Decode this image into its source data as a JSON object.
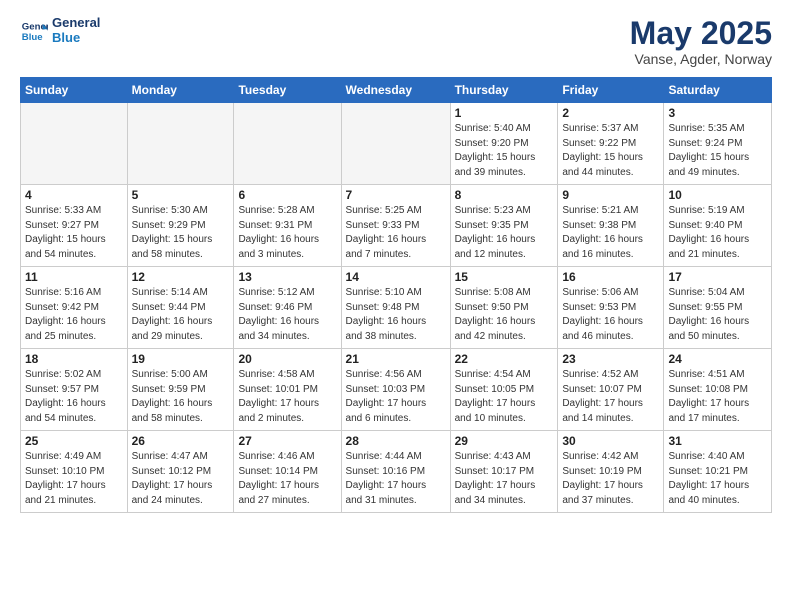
{
  "logo": {
    "line1": "General",
    "line2": "Blue"
  },
  "title": "May 2025",
  "subtitle": "Vanse, Agder, Norway",
  "days_of_week": [
    "Sunday",
    "Monday",
    "Tuesday",
    "Wednesday",
    "Thursday",
    "Friday",
    "Saturday"
  ],
  "weeks": [
    [
      {
        "day": "",
        "info": ""
      },
      {
        "day": "",
        "info": ""
      },
      {
        "day": "",
        "info": ""
      },
      {
        "day": "",
        "info": ""
      },
      {
        "day": "1",
        "info": "Sunrise: 5:40 AM\nSunset: 9:20 PM\nDaylight: 15 hours\nand 39 minutes."
      },
      {
        "day": "2",
        "info": "Sunrise: 5:37 AM\nSunset: 9:22 PM\nDaylight: 15 hours\nand 44 minutes."
      },
      {
        "day": "3",
        "info": "Sunrise: 5:35 AM\nSunset: 9:24 PM\nDaylight: 15 hours\nand 49 minutes."
      }
    ],
    [
      {
        "day": "4",
        "info": "Sunrise: 5:33 AM\nSunset: 9:27 PM\nDaylight: 15 hours\nand 54 minutes."
      },
      {
        "day": "5",
        "info": "Sunrise: 5:30 AM\nSunset: 9:29 PM\nDaylight: 15 hours\nand 58 minutes."
      },
      {
        "day": "6",
        "info": "Sunrise: 5:28 AM\nSunset: 9:31 PM\nDaylight: 16 hours\nand 3 minutes."
      },
      {
        "day": "7",
        "info": "Sunrise: 5:25 AM\nSunset: 9:33 PM\nDaylight: 16 hours\nand 7 minutes."
      },
      {
        "day": "8",
        "info": "Sunrise: 5:23 AM\nSunset: 9:35 PM\nDaylight: 16 hours\nand 12 minutes."
      },
      {
        "day": "9",
        "info": "Sunrise: 5:21 AM\nSunset: 9:38 PM\nDaylight: 16 hours\nand 16 minutes."
      },
      {
        "day": "10",
        "info": "Sunrise: 5:19 AM\nSunset: 9:40 PM\nDaylight: 16 hours\nand 21 minutes."
      }
    ],
    [
      {
        "day": "11",
        "info": "Sunrise: 5:16 AM\nSunset: 9:42 PM\nDaylight: 16 hours\nand 25 minutes."
      },
      {
        "day": "12",
        "info": "Sunrise: 5:14 AM\nSunset: 9:44 PM\nDaylight: 16 hours\nand 29 minutes."
      },
      {
        "day": "13",
        "info": "Sunrise: 5:12 AM\nSunset: 9:46 PM\nDaylight: 16 hours\nand 34 minutes."
      },
      {
        "day": "14",
        "info": "Sunrise: 5:10 AM\nSunset: 9:48 PM\nDaylight: 16 hours\nand 38 minutes."
      },
      {
        "day": "15",
        "info": "Sunrise: 5:08 AM\nSunset: 9:50 PM\nDaylight: 16 hours\nand 42 minutes."
      },
      {
        "day": "16",
        "info": "Sunrise: 5:06 AM\nSunset: 9:53 PM\nDaylight: 16 hours\nand 46 minutes."
      },
      {
        "day": "17",
        "info": "Sunrise: 5:04 AM\nSunset: 9:55 PM\nDaylight: 16 hours\nand 50 minutes."
      }
    ],
    [
      {
        "day": "18",
        "info": "Sunrise: 5:02 AM\nSunset: 9:57 PM\nDaylight: 16 hours\nand 54 minutes."
      },
      {
        "day": "19",
        "info": "Sunrise: 5:00 AM\nSunset: 9:59 PM\nDaylight: 16 hours\nand 58 minutes."
      },
      {
        "day": "20",
        "info": "Sunrise: 4:58 AM\nSunset: 10:01 PM\nDaylight: 17 hours\nand 2 minutes."
      },
      {
        "day": "21",
        "info": "Sunrise: 4:56 AM\nSunset: 10:03 PM\nDaylight: 17 hours\nand 6 minutes."
      },
      {
        "day": "22",
        "info": "Sunrise: 4:54 AM\nSunset: 10:05 PM\nDaylight: 17 hours\nand 10 minutes."
      },
      {
        "day": "23",
        "info": "Sunrise: 4:52 AM\nSunset: 10:07 PM\nDaylight: 17 hours\nand 14 minutes."
      },
      {
        "day": "24",
        "info": "Sunrise: 4:51 AM\nSunset: 10:08 PM\nDaylight: 17 hours\nand 17 minutes."
      }
    ],
    [
      {
        "day": "25",
        "info": "Sunrise: 4:49 AM\nSunset: 10:10 PM\nDaylight: 17 hours\nand 21 minutes."
      },
      {
        "day": "26",
        "info": "Sunrise: 4:47 AM\nSunset: 10:12 PM\nDaylight: 17 hours\nand 24 minutes."
      },
      {
        "day": "27",
        "info": "Sunrise: 4:46 AM\nSunset: 10:14 PM\nDaylight: 17 hours\nand 27 minutes."
      },
      {
        "day": "28",
        "info": "Sunrise: 4:44 AM\nSunset: 10:16 PM\nDaylight: 17 hours\nand 31 minutes."
      },
      {
        "day": "29",
        "info": "Sunrise: 4:43 AM\nSunset: 10:17 PM\nDaylight: 17 hours\nand 34 minutes."
      },
      {
        "day": "30",
        "info": "Sunrise: 4:42 AM\nSunset: 10:19 PM\nDaylight: 17 hours\nand 37 minutes."
      },
      {
        "day": "31",
        "info": "Sunrise: 4:40 AM\nSunset: 10:21 PM\nDaylight: 17 hours\nand 40 minutes."
      }
    ]
  ]
}
